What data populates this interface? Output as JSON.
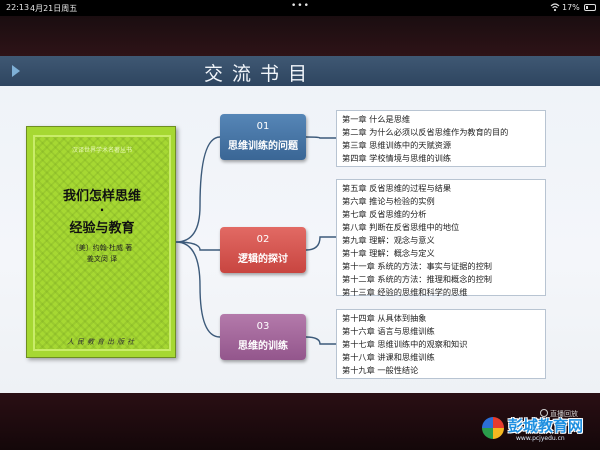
{
  "status_bar": {
    "time": "22:13",
    "date": "4月21日周五",
    "dots": "•••",
    "battery": "17%"
  },
  "slide": {
    "title": "交流书目",
    "book": {
      "series": "汉译世界学术名著丛书",
      "title_line1": "我们怎样思维",
      "title_dot": "·",
      "title_line2": "经验与教育",
      "author": "〔美〕约翰·杜威 著",
      "translator": "姜文闵 译",
      "publisher": "人民教育出版社"
    },
    "sections": [
      {
        "number": "01",
        "label": "思维训练的问题",
        "color": "#4a78a8",
        "chapters": [
          "第一章  什么是思维",
          "第二章  为什么必须以反省思维作为教育的目的",
          "第三章  思维训练中的天赋资源",
          "第四章  学校情境与思维的训练"
        ]
      },
      {
        "number": "02",
        "label": "逻辑的探讨",
        "color": "#d5544f",
        "chapters": [
          "第五章  反省思维的过程与结果",
          "第六章  推论与检验的实例",
          "第七章  反省思维的分析",
          "第八章  判断在反省思维中的地位",
          "第九章  理解：观念与意义",
          "第十章  理解：概念与定义",
          "第十一章  系统的方法：事实与证据的控制",
          "第十二章  系统的方法：推理和概念的控制",
          "第十三章  经验的思维和科学的思维"
        ]
      },
      {
        "number": "03",
        "label": "思维的训练",
        "color": "#a56a9c",
        "chapters": [
          "第十四章  从具体到抽象",
          "第十六章  语言与思维训练",
          "第十七章  思维训练中的观察和知识",
          "第十八章  讲课和思维训练",
          "第十九章  一般性结论"
        ]
      }
    ]
  },
  "overlay": {
    "replay_label": "直播回放",
    "watermark_name": "彭城教育网",
    "watermark_url": "www.pcjyedu.cn"
  }
}
